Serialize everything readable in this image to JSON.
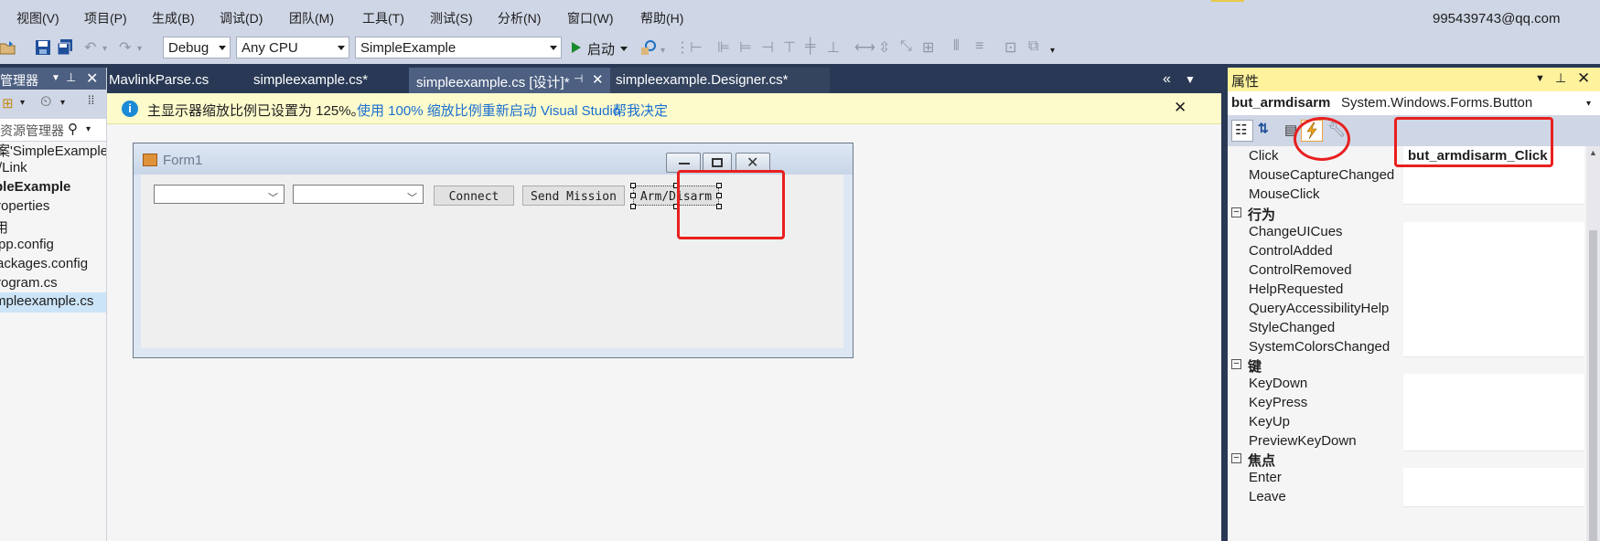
{
  "menu": {
    "items": [
      "视图(V)",
      "项目(P)",
      "生成(B)",
      "调试(D)",
      "团队(M)",
      "工具(T)",
      "测试(S)",
      "分析(N)",
      "窗口(W)",
      "帮助(H)"
    ],
    "user": "995439743@qq.com"
  },
  "toolbar": {
    "config": "Debug",
    "platform": "Any CPU",
    "project": "SimpleExample",
    "start_label": "启动"
  },
  "solution_explorer": {
    "title": "管理器",
    "search_placeholder": "资源管理器",
    "items": [
      "案'SimpleExample",
      "/Link",
      "pleExample",
      "roperties",
      "用",
      "pp.config",
      "ackages.config",
      "rogram.cs",
      "mpleexample.cs"
    ]
  },
  "tabs": [
    {
      "label": "MavlinkParse.cs"
    },
    {
      "label": "simpleexample.cs*"
    },
    {
      "label": "simpleexample.cs [设计]*"
    },
    {
      "label": "simpleexample.Designer.cs*"
    }
  ],
  "infobar": {
    "message": "主显示器缩放比例已设置为 125%。",
    "link_restart": "使用 100% 缩放比例重新启动 Visual Studio",
    "link_help": "帮我决定"
  },
  "form": {
    "title": "Form1",
    "buttons": {
      "connect": "Connect",
      "send_mission": "Send Mission",
      "arm_disarm": "Arm/Disarm"
    }
  },
  "properties": {
    "title": "属性",
    "object_name": "but_armdisarm",
    "object_type": "System.Windows.Forms.Button",
    "rows_top": [
      {
        "name": "Click",
        "value": "but_armdisarm_Click"
      },
      {
        "name": "MouseCaptureChanged",
        "value": ""
      },
      {
        "name": "MouseClick",
        "value": ""
      }
    ],
    "cat_behavior": "行为",
    "rows_behavior": [
      {
        "name": "ChangeUICues"
      },
      {
        "name": "ControlAdded"
      },
      {
        "name": "ControlRemoved"
      },
      {
        "name": "HelpRequested"
      },
      {
        "name": "QueryAccessibilityHelp"
      },
      {
        "name": "StyleChanged"
      },
      {
        "name": "SystemColorsChanged"
      }
    ],
    "cat_key": "键",
    "rows_key": [
      {
        "name": "KeyDown"
      },
      {
        "name": "KeyPress"
      },
      {
        "name": "KeyUp"
      },
      {
        "name": "PreviewKeyDown"
      }
    ],
    "cat_focus": "焦点",
    "rows_focus": [
      {
        "name": "Enter"
      },
      {
        "name": "Leave"
      }
    ],
    "collapse_glyph": "⊟"
  },
  "colors": {
    "chrome_dark": "#293955",
    "highlight_red": "#e8201f",
    "props_header": "#fff29d",
    "info_bar": "#fdfbcc"
  }
}
